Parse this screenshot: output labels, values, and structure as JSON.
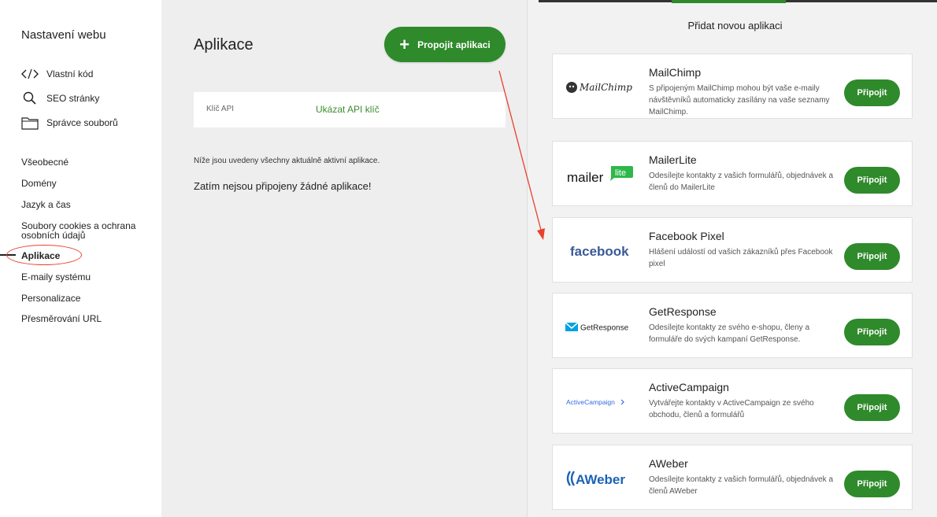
{
  "sidebar": {
    "title": "Nastavení webu",
    "tools": [
      {
        "label": "Vlastní kód",
        "icon": "code-icon"
      },
      {
        "label": "SEO stránky",
        "icon": "search-icon"
      },
      {
        "label": "Správce souborů",
        "icon": "folder-icon"
      }
    ],
    "nav": [
      {
        "label": "Všeobecné"
      },
      {
        "label": "Domény"
      },
      {
        "label": "Jazyk a čas"
      },
      {
        "label": "Soubory cookies a ochrana osobních údajů"
      },
      {
        "label": "Aplikace"
      },
      {
        "label": "E-maily systému"
      },
      {
        "label": "Personalizace"
      },
      {
        "label": "Přesměrování URL"
      }
    ]
  },
  "main": {
    "title": "Aplikace",
    "connect_button": "Propojit aplikaci",
    "api_label": "Klíč API",
    "api_link": "Ukázat API klíč",
    "info_text": "Níže jsou uvedeny všechny aktuálně aktivní aplikace.",
    "empty_text": "Zatím nejsou připojeny žádné aplikace!"
  },
  "panel": {
    "title": "Přidat novou aplikaci",
    "apps": [
      {
        "name": "MailChimp",
        "desc": "S připojeným MailChimp mohou být vaše e-maily návštěvníků automaticky zasílány na vaše seznamy MailChimp.",
        "button": "Připojit",
        "logo": "MailChimp"
      },
      {
        "name": "MailerLite",
        "desc": "Odesílejte kontakty z vašich formulářů, objednávek a členů do MailerLite",
        "button": "Připojit",
        "logo": "mailer lite"
      },
      {
        "name": "Facebook Pixel",
        "desc": "Hlášení událostí od vašich zákazníků přes Facebook pixel",
        "button": "Připojit",
        "logo": "facebook"
      },
      {
        "name": "GetResponse",
        "desc": "Odesílejte kontakty ze svého e-shopu, členy a formuláře do svých kampaní GetResponse.",
        "button": "Připojit",
        "logo": "GetResponse"
      },
      {
        "name": "ActiveCampaign",
        "desc": "Vytvářejte kontakty v ActiveCampaign ze svého obchodu, členů a formulářů",
        "button": "Připojit",
        "logo": "ActiveCampaign"
      },
      {
        "name": "AWeber",
        "desc": "Odesílejte kontakty z vašich formulářů, objednávek a členů AWeber",
        "button": "Připojit",
        "logo": "AWeber"
      }
    ]
  },
  "colors": {
    "accent": "#2f8a2b",
    "annotation": "#e8412c"
  }
}
